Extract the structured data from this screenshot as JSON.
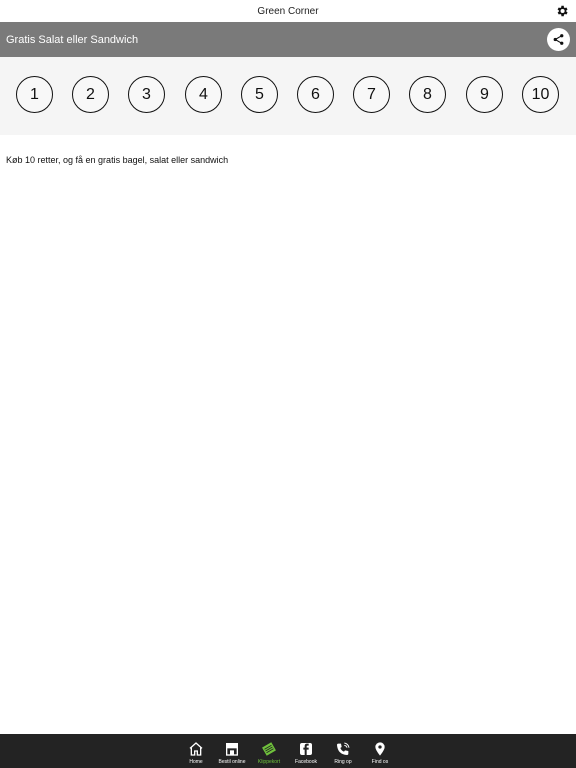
{
  "app": {
    "title": "Green Corner"
  },
  "icons": {
    "settings": "gear-icon",
    "share": "share-icon"
  },
  "header": {
    "title": "Gratis Salat eller Sandwich"
  },
  "stamps": [
    "1",
    "2",
    "3",
    "4",
    "5",
    "6",
    "7",
    "8",
    "9",
    "10"
  ],
  "description": "Køb 10 retter, og få en gratis bagel, salat eller sandwich",
  "nav": {
    "items": [
      {
        "label": "Home",
        "icon": "home-icon"
      },
      {
        "label": "Bestil online",
        "icon": "store-icon"
      },
      {
        "label": "Klippekort",
        "icon": "punch-card-icon",
        "active": true
      },
      {
        "label": "Facebook",
        "icon": "facebook-icon"
      },
      {
        "label": "Ring op",
        "icon": "phone-icon"
      },
      {
        "label": "Find os",
        "icon": "map-pin-icon"
      }
    ]
  },
  "colors": {
    "header_bg": "#7a7a7a",
    "panel_bg": "#f5f5f5",
    "nav_bg": "#232323",
    "active": "#6fc13c"
  }
}
